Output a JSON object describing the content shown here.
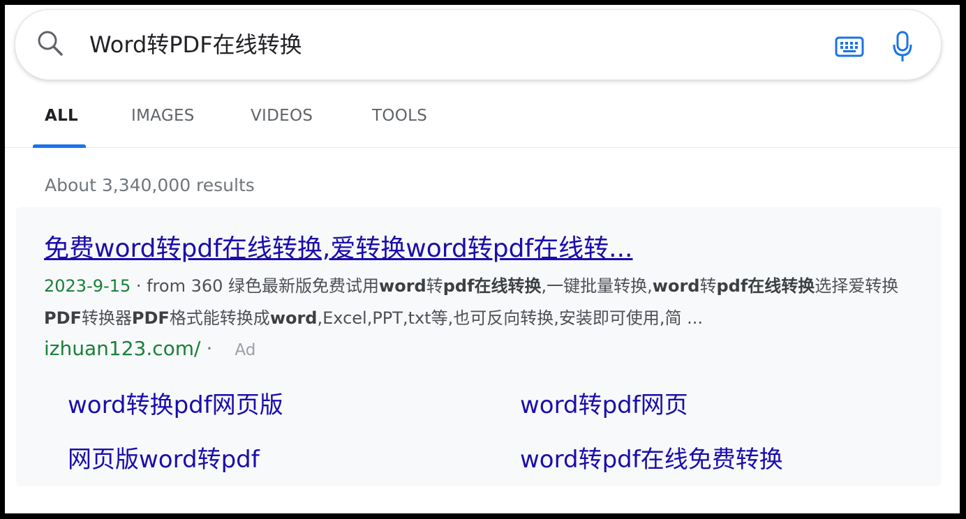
{
  "search": {
    "query": "Word转PDF在线转换",
    "search_icon": "search-icon",
    "keyboard_icon": "keyboard-icon",
    "mic_icon": "microphone-icon"
  },
  "tabs": [
    {
      "label": "ALL",
      "active": true
    },
    {
      "label": "IMAGES",
      "active": false
    },
    {
      "label": "VIDEOS",
      "active": false
    },
    {
      "label": "TOOLS",
      "active": false
    }
  ],
  "results": {
    "count_text": "About 3,340,000 results"
  },
  "ad": {
    "title": "免费word转pdf在线转换,爱转换word转pdf在线转...",
    "date": "2023-9-15",
    "separator": " · ",
    "snippet_parts": [
      {
        "text": "from 360 绿色最新版免费试用",
        "bold": false
      },
      {
        "text": "word",
        "bold": true
      },
      {
        "text": "转",
        "bold": false
      },
      {
        "text": "pdf在线转换",
        "bold": true
      },
      {
        "text": ",一键批量转换,",
        "bold": false
      },
      {
        "text": "word",
        "bold": true
      },
      {
        "text": "转",
        "bold": false
      },
      {
        "text": "pdf在线转换",
        "bold": true
      },
      {
        "text": "选择爱转换",
        "bold": false
      },
      {
        "text": "PDF",
        "bold": true
      },
      {
        "text": "转换器",
        "bold": false
      },
      {
        "text": "PDF",
        "bold": true
      },
      {
        "text": "格式能转换成",
        "bold": false
      },
      {
        "text": "word",
        "bold": true
      },
      {
        "text": ",Excel,PPT,txt等,也可反向转换,安装即可使用,简 ...",
        "bold": false
      }
    ],
    "url": "izhuan123.com/",
    "url_dot": "·",
    "badge": "Ad",
    "sitelinks": [
      {
        "label": "word转换pdf网页版"
      },
      {
        "label": "word转pdf网页"
      },
      {
        "label": "网页版word转pdf"
      },
      {
        "label": "word转pdf在线免费转换"
      }
    ]
  },
  "colors": {
    "link": "#1a0dab",
    "url_green": "#188038",
    "tab_accent": "#1a73e8"
  }
}
